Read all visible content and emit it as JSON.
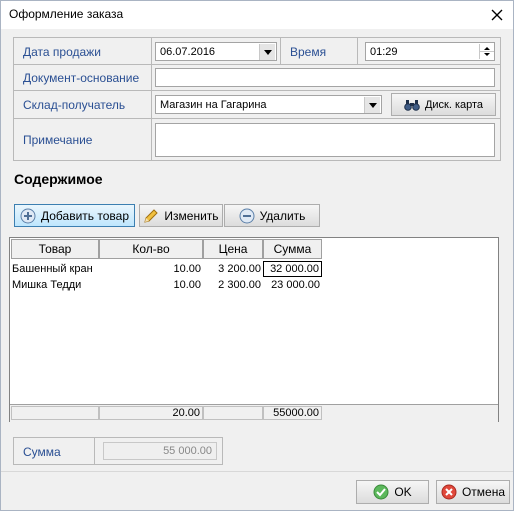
{
  "window": {
    "title": "Оформление заказа"
  },
  "form": {
    "sale_date_label": "Дата продажи",
    "sale_date_value": "06.07.2016",
    "time_label": "Время",
    "time_value": "01:29",
    "base_doc_label": "Документ-основание",
    "base_doc_value": "",
    "warehouse_label": "Склад-получатель",
    "warehouse_value": "Магазин на Гагарина",
    "card_button": "Диск. карта",
    "note_label": "Примечание",
    "note_value": ""
  },
  "contents": {
    "title": "Содержимое",
    "toolbar": {
      "add": "Добавить товар",
      "edit": "Изменить",
      "delete": "Удалить"
    },
    "columns": [
      "Товар",
      "Кол-во",
      "Цена",
      "Сумма"
    ],
    "rows": [
      {
        "item": "Башенный кран",
        "qty": "10.00",
        "price": "3 200.00",
        "sum": "32 000.00"
      },
      {
        "item": "Мишка Тедди",
        "qty": "10.00",
        "price": "2 300.00",
        "sum": "23 000.00"
      }
    ],
    "footer": {
      "qty_total": "20.00",
      "sum_total": "55000.00"
    }
  },
  "total": {
    "label": "Сумма",
    "value": "55 000.00"
  },
  "buttons": {
    "ok": "OK",
    "cancel": "Отмена"
  },
  "colors": {
    "label_blue": "#2a4f93",
    "ok_green": "#4caf50",
    "cancel_red": "#d9382c"
  }
}
